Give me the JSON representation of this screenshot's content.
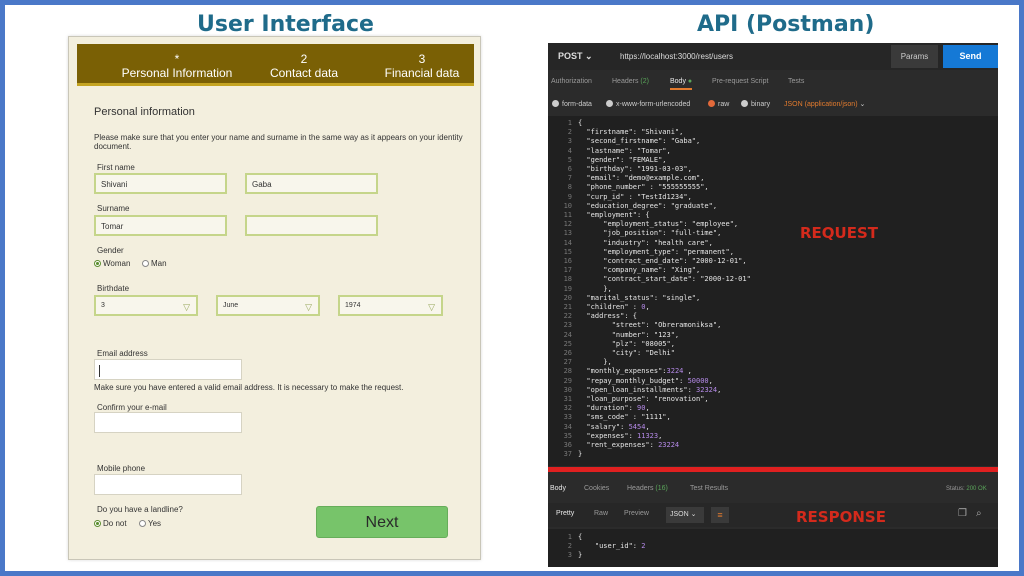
{
  "titles": {
    "ui": "User Interface",
    "api": "API (Postman)"
  },
  "form": {
    "steps": [
      {
        "num": "*",
        "label": "Personal Information"
      },
      {
        "num": "2",
        "label": "Contact data"
      },
      {
        "num": "3",
        "label": "Financial data"
      }
    ],
    "section_title": "Personal information",
    "intro": "Please make sure that you enter your name and surname in the same way as it appears on your identity document.",
    "first_name_label": "First name",
    "first_name": "Shivani",
    "second_name": "Gaba",
    "surname_label": "Surname",
    "surname": "Tomar",
    "surname2": "",
    "gender_label": "Gender",
    "gender_options": [
      "Woman",
      "Man"
    ],
    "birthdate_label": "Birthdate",
    "birth_day": "3",
    "birth_month": "June",
    "birth_year": "1974",
    "email_label": "Email address",
    "email_value": "",
    "email_help": "Make sure you have entered a valid email address. It is necessary to make the request.",
    "confirm_email_label": "Confirm your e-mail",
    "confirm_email_value": "",
    "mobile_label": "Mobile phone",
    "mobile_value": "",
    "landline_label": "Do you have a landline?",
    "landline_options": [
      "Do not",
      "Yes"
    ],
    "next_label": "Next"
  },
  "postman": {
    "method": "POST",
    "url": "https://localhost:3000/rest/users",
    "params_label": "Params",
    "send_label": "Send",
    "tabs": [
      "Authorization",
      "Headers",
      "Body",
      "Pre-request Script",
      "Tests"
    ],
    "headers_count": "(2)",
    "body_dot": "●",
    "body_options": [
      "form-data",
      "x-www-form-urlencoded",
      "raw",
      "binary",
      "JSON (application/json)"
    ],
    "request_label": "REQUEST",
    "response_label": "RESPONSE",
    "request_lines": [
      "{",
      "  \"firstname\": \"Shivani\",",
      "  \"second_firstname\": \"Gaba\",",
      "  \"lastname\": \"Tomar\",",
      "  \"gender\": \"FEMALE\",",
      "  \"birthday\": \"1991-03-03\",",
      "  \"email\": \"demo@example.com\",",
      "  \"phone_number\" : \"555555555\",",
      "  \"curp_id\" : \"TestId1234\",",
      "  \"education_degree\": \"graduate\",",
      "  \"employment\": {",
      "      \"employment_status\": \"employee\",",
      "      \"job_position\": \"full-time\",",
      "      \"industry\": \"health care\",",
      "      \"employment_type\": \"permanent\",",
      "      \"contract_end_date\": \"2000-12-01\",",
      "      \"company_name\": \"Xing\",",
      "      \"contract_start_date\": \"2000-12-01\"",
      "      },",
      "  \"marital_status\": \"single\",",
      "  \"children\" : 0,",
      "  \"address\": {",
      "        \"street\": \"Obreramoniksa\",",
      "        \"number\": \"123\",",
      "        \"plz\": \"08005\",",
      "        \"city\": \"Delhi\"",
      "      },",
      "  \"monthly_expenses\":3224 ,",
      "  \"repay_monthly_budget\": 50000,",
      "  \"open_loan_installments\": 32324,",
      "  \"loan_purpose\": \"renovation\",",
      "  \"duration\": 90,",
      "  \"sms_code\" : \"1111\",",
      "  \"salary\": 5454,",
      "  \"expenses\": 11323,",
      "  \"rent_expenses\": 23224",
      "}"
    ],
    "response_tabs": [
      "Body",
      "Cookies",
      "Headers",
      "Test Results"
    ],
    "response_headers_count": "(16)",
    "status_label": "Status:",
    "status_value": "200 OK",
    "response_view": [
      "Pretty",
      "Raw",
      "Preview"
    ],
    "response_format": "JSON",
    "response_lines": [
      "{",
      "    \"user_id\": 2",
      "}"
    ],
    "accent_color": "#e27b2e",
    "send_color": "#1579d6",
    "label_color": "#d42a1c"
  }
}
